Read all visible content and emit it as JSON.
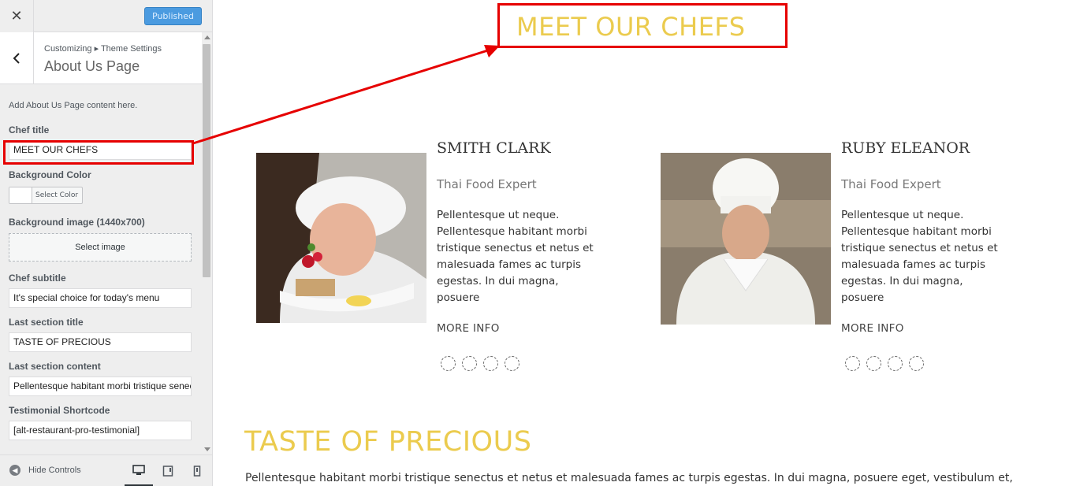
{
  "header": {
    "close_icon": "close-icon",
    "publish_label": "Published"
  },
  "section": {
    "breadcrumb": "Customizing ▸ Theme Settings",
    "title": "About Us Page",
    "description": "Add About Us Page content here."
  },
  "controls": {
    "chef_title_label": "Chef title",
    "chef_title_value": "MEET OUR CHEFS",
    "bg_color_label": "Background Color",
    "select_color_label": "Select Color",
    "bg_image_label": "Background image (1440x700)",
    "select_image_label": "Select image",
    "chef_subtitle_label": "Chef subtitle",
    "chef_subtitle_value": "It's special choice for today's menu",
    "last_title_label": "Last section title",
    "last_title_value": "TASTE OF PRECIOUS",
    "last_content_label": "Last section content",
    "last_content_value": "Pellentesque habitant morbi tristique senectus et netus",
    "testimonial_label": "Testimonial Shortcode",
    "testimonial_value": "[alt-restaurant-pro-testimonial]"
  },
  "footer": {
    "hide_controls_label": "Hide Controls"
  },
  "preview": {
    "title": "MEET OUR CHEFS",
    "chefs": [
      {
        "name": "SMITH CLARK",
        "role": "Thai Food Expert",
        "bio": "Pellentesque ut neque. Pellentesque habitant morbi tristique senectus et netus et malesuada fames ac turpis egestas. In dui magna, posuere",
        "more": "MORE INFO"
      },
      {
        "name": "RUBY ELEANOR",
        "role": "Thai Food Expert",
        "bio": "Pellentesque ut neque. Pellentesque habitant morbi tristique senectus et netus et malesuada fames ac turpis egestas. In dui magna, posuere",
        "more": "MORE INFO"
      }
    ],
    "taste_title": "TASTE OF PRECIOUS",
    "taste_text": "Pellentesque habitant morbi tristique senectus et netus et malesuada fames ac turpis egestas. In dui magna, posuere eget, vestibulum et,"
  },
  "colors": {
    "accent_gold": "#ebcb4e",
    "publish_blue": "#4b9be0",
    "annotation_red": "#e60000"
  }
}
